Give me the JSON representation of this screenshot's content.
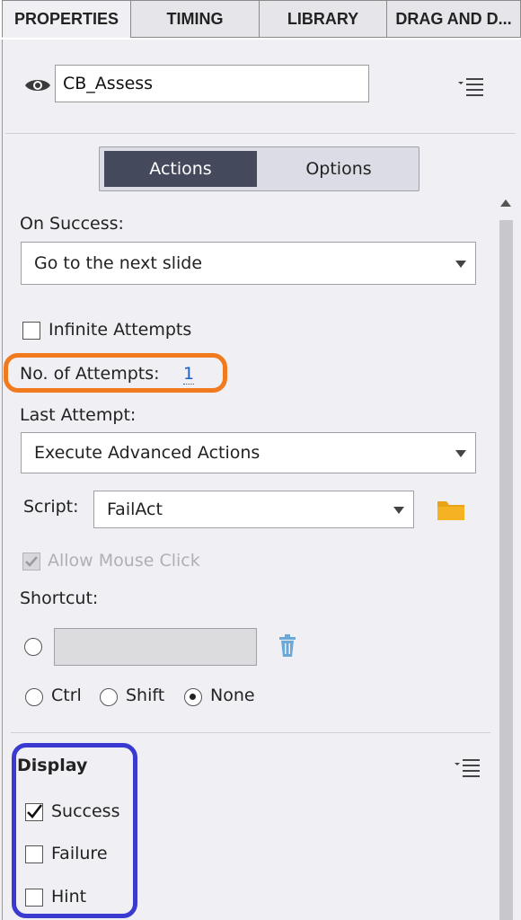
{
  "tabs": [
    "PROPERTIES",
    "TIMING",
    "LIBRARY",
    "DRAG AND D..."
  ],
  "object_name": "CB_Assess",
  "segmented": {
    "actions": "Actions",
    "options": "Options",
    "selected": "Actions"
  },
  "on_success": {
    "label": "On Success:",
    "value": "Go to the next slide"
  },
  "infinite_attempts": {
    "label": "Infinite Attempts",
    "checked": false
  },
  "attempts": {
    "label": "No. of Attempts:",
    "value": "1"
  },
  "last_attempt": {
    "label": "Last Attempt:",
    "value": "Execute Advanced Actions"
  },
  "script": {
    "label": "Script:",
    "value": "FailAct"
  },
  "allow_mouse_click": {
    "label": "Allow Mouse Click",
    "checked": true,
    "disabled": true
  },
  "shortcut": {
    "label": "Shortcut:",
    "modifiers": [
      "Ctrl",
      "Shift",
      "None"
    ],
    "selected": "None"
  },
  "display": {
    "title": "Display",
    "items": [
      {
        "label": "Success",
        "checked": true
      },
      {
        "label": "Failure",
        "checked": false
      },
      {
        "label": "Hint",
        "checked": false
      }
    ]
  },
  "colors": {
    "active_segment": "#44495c",
    "highlight_orange": "#f27a1e",
    "highlight_blue": "#3a3ad0",
    "folder": "#e8a317",
    "trash": "#6aa8d8"
  }
}
